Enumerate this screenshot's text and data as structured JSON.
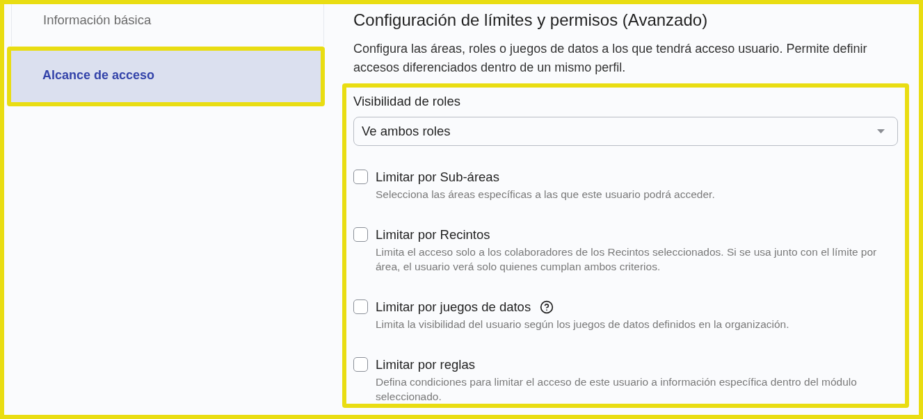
{
  "sidebar": {
    "items": [
      {
        "label": "Información básica",
        "selected": false
      },
      {
        "label": "Alcance de acceso",
        "selected": true
      }
    ]
  },
  "section": {
    "title": "Configuración de límites y permisos (Avanzado)",
    "description": "Configura las áreas, roles o juegos de datos a los que tendrá acceso usuario. Permite definir accesos diferenciados dentro de un mismo perfil.",
    "role_visibility": {
      "label": "Visibilidad de roles",
      "value": "Ve ambos roles"
    },
    "options": [
      {
        "label": "Limitar por Sub-áreas",
        "description": "Selecciona las áreas específicas a las que este usuario podrá acceder.",
        "checked": false
      },
      {
        "label": "Limitar por Recintos",
        "description": "Limita el acceso solo a los colaboradores de los Recintos seleccionados. Si se usa junto con el límite por área, el usuario verá solo quienes cumplan ambos criterios.",
        "checked": false
      },
      {
        "label": "Limitar por juegos de datos",
        "description": "Limita la visibilidad del usuario según los juegos de datos definidos en la organización.",
        "checked": false,
        "help": true
      },
      {
        "label": "Limitar por reglas",
        "description": "Defina condiciones para limitar el acceso de este usuario a información específica dentro del módulo seleccionado.",
        "checked": false
      }
    ]
  }
}
